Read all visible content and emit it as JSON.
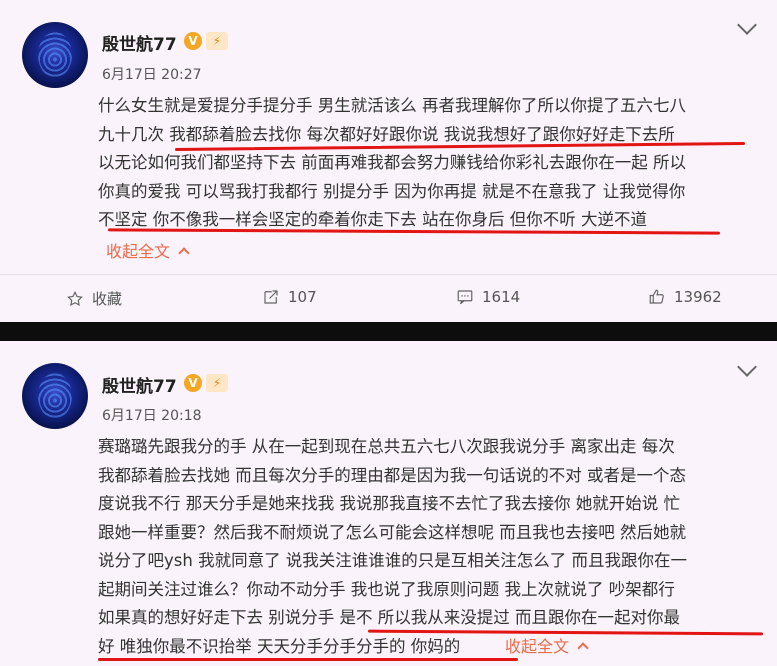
{
  "post1": {
    "user": {
      "name": "殷世航77",
      "v_badge": "V"
    },
    "date": "6月17日 20:27",
    "lines": [
      "什么女生就是爱提分手提分手 男生就活该么 再者我理解你了所以你提了五六七八",
      "九十几次 我都舔着脸去找你 每次都好好跟你说 我说我想好了跟你好好走下去所",
      "以无论如何我们都坚持下去 前面再难我都会努力赚钱给你彩礼去跟你在一起 所以",
      "你真的爱我 可以骂我打我都行 别提分手 因为你再提 就是不在意我了 让我觉得你",
      "不坚定 你不像我一样会坚定的牵着你走下去 站在你身后 但你不听 大逆不道"
    ],
    "fold_label": "收起全文",
    "actions": {
      "favorite_label": "收藏",
      "repost_count": "107",
      "comment_count": "1614",
      "like_count": "13962"
    }
  },
  "post2": {
    "user": {
      "name": "殷世航77",
      "v_badge": "V"
    },
    "date": "6月17日 20:18",
    "lines": [
      "赛璐璐先跟我分的手 从在一起到现在总共五六七八次跟我说分手 离家出走 每次",
      "我都舔着脸去找她 而且每次分手的理由都是因为我一句话说的不对 或者是一个态",
      "度说我不行 那天分手是她来找我 我说那我直接不去忙了我去接你 她就开始说 忙",
      "跟她一样重要？然后我不耐烦说了怎么可能会这样想呢 而且我也去接吧 然后她就",
      "说分了吧ysh 我就同意了 说我关注谁谁谁的只是互相关注怎么了 而且我跟你在一",
      "起期间关注过谁么？你动不动分手 我也说了我原则问题 我上次就说了 吵架都行",
      "如果真的想好好走下去 别说分手 是不 所以我从来没提过 而且跟你在一起对你最",
      "好 唯独你最不识抬举 天天分手分手分手的 你妈的"
    ],
    "fold_label": "收起全文"
  },
  "colors": {
    "underline": "#e21414",
    "fold_link": "#ec6b4a",
    "v_badge": "#f5a623",
    "post_bg": "#faf3fb",
    "separator": "#0d0d0d"
  }
}
